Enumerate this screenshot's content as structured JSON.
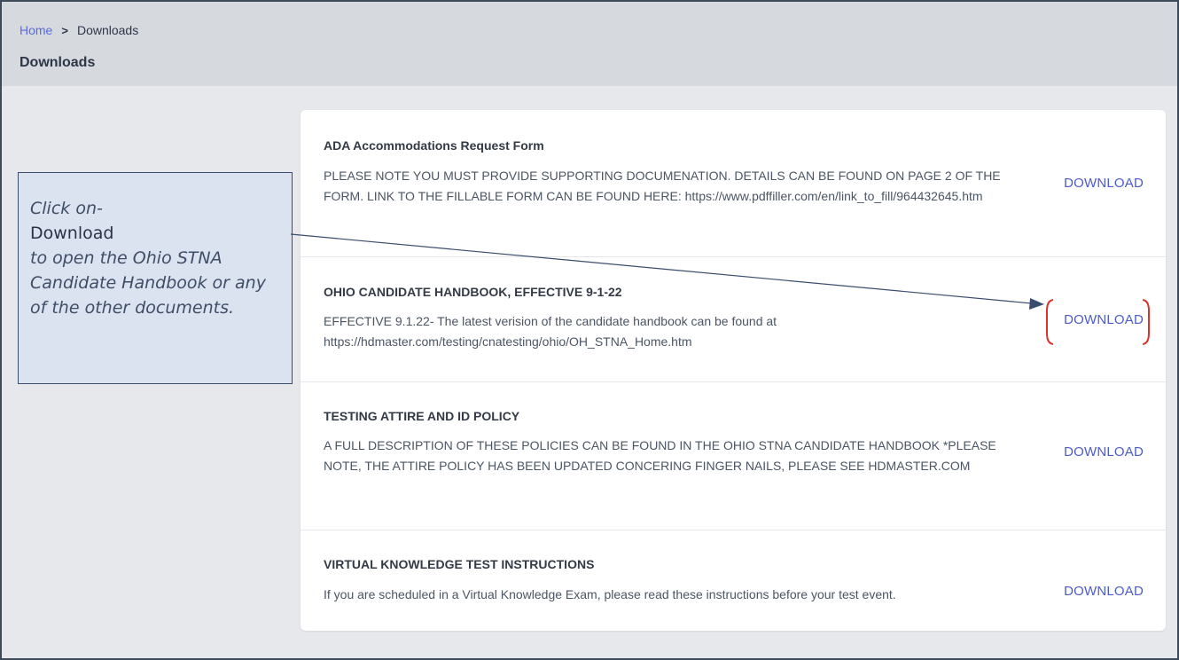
{
  "breadcrumb": {
    "home": "Home",
    "separator": ">",
    "current": "Downloads"
  },
  "page_title": "Downloads",
  "downloads": [
    {
      "title": "ADA Accommodations Request Form",
      "description": "PLEASE NOTE YOU MUST PROVIDE SUPPORTING DOCUMENATION. DETAILS CAN BE FOUND ON PAGE 2 OF THE FORM. LINK TO THE FILLABLE FORM CAN BE FOUND HERE: https://www.pdffiller.com/en/link_to_fill/964432645.htm",
      "button": "DOWNLOAD"
    },
    {
      "title": "OHIO CANDIDATE HANDBOOK, EFFECTIVE 9-1-22",
      "description": "EFFECTIVE 9.1.22- The latest verision of the candidate handbook can be found at https://hdmaster.com/testing/cnatesting/ohio/OH_STNA_Home.htm",
      "button": "DOWNLOAD"
    },
    {
      "title": "TESTING ATTIRE AND ID POLICY",
      "description": "A FULL DESCRIPTION OF THESE POLICIES CAN BE FOUND IN THE OHIO STNA CANDIDATE HANDBOOK *PLEASE NOTE, THE ATTIRE POLICY HAS BEEN UPDATED CONCERING FINGER NAILS, PLEASE SEE HDMASTER.COM",
      "button": "DOWNLOAD"
    },
    {
      "title": "VIRTUAL KNOWLEDGE TEST INSTRUCTIONS",
      "description": "If you are scheduled in a Virtual Knowledge Exam, please read these instructions before your test event.",
      "button": "DOWNLOAD"
    }
  ],
  "callout": {
    "line1": "Click on-",
    "line2": "Download",
    "line3": "to open the Ohio STNA Candidate Handbook or any of the other documents."
  },
  "colors": {
    "link": "#5b6be0",
    "download": "#4c5bc9",
    "highlight_bracket": "#e0302a",
    "callout_bg": "#dbe3f1"
  }
}
